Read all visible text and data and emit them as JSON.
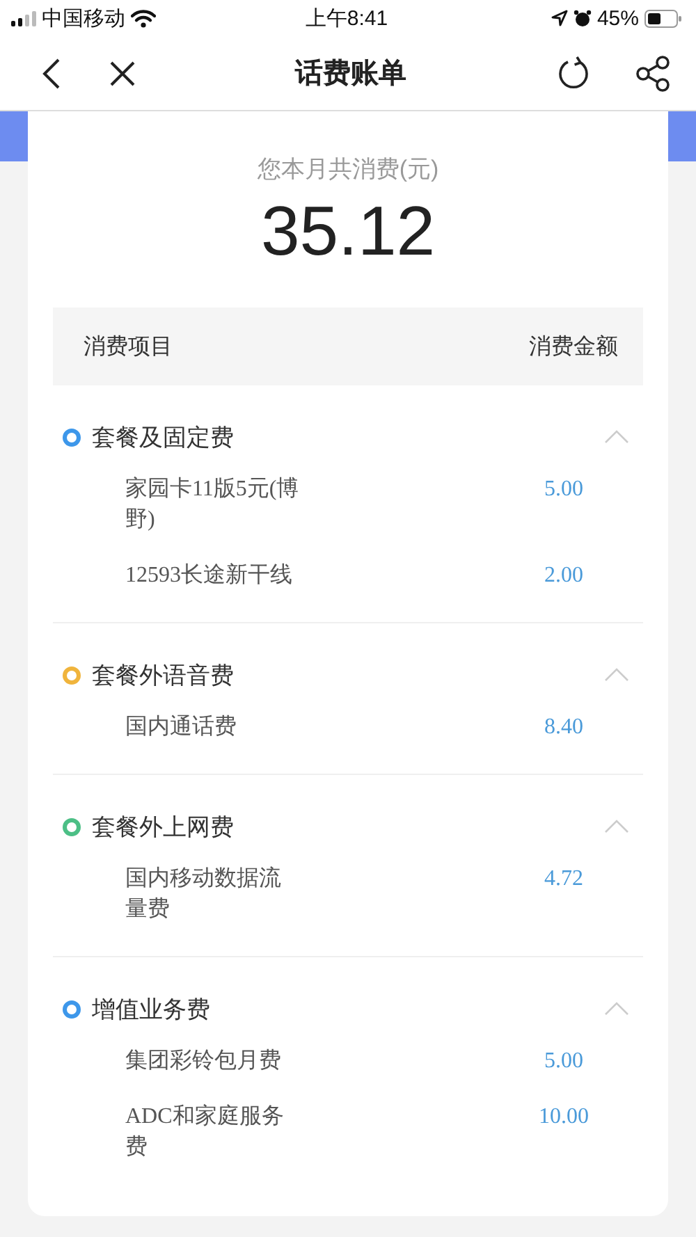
{
  "status_bar": {
    "carrier": "中国移动",
    "time": "上午8:41",
    "battery": "45%"
  },
  "nav": {
    "title": "话费账单"
  },
  "summary": {
    "label": "您本月共消费(元)",
    "total": "35.12"
  },
  "table_header": {
    "item": "消费项目",
    "amount": "消费金额"
  },
  "sections": [
    {
      "title": "套餐及固定费",
      "color": "#3d97ea",
      "expanded": true,
      "items": [
        {
          "name": "家园卡11版5元(博野)",
          "amount": "5.00"
        },
        {
          "name": "12593长途新干线",
          "amount": "2.00"
        }
      ]
    },
    {
      "title": "套餐外语音费",
      "color": "#f0b43c",
      "expanded": true,
      "items": [
        {
          "name": "国内通话费",
          "amount": "8.40"
        }
      ]
    },
    {
      "title": "套餐外上网费",
      "color": "#4cbf86",
      "expanded": true,
      "items": [
        {
          "name": "国内移动数据流量费",
          "amount": "4.72"
        }
      ]
    },
    {
      "title": "增值业务费",
      "color": "#3d97ea",
      "expanded": true,
      "items": [
        {
          "name": "集团彩铃包月费",
          "amount": "5.00"
        },
        {
          "name": "ADC和家庭服务费",
          "amount": "10.00"
        }
      ]
    }
  ]
}
